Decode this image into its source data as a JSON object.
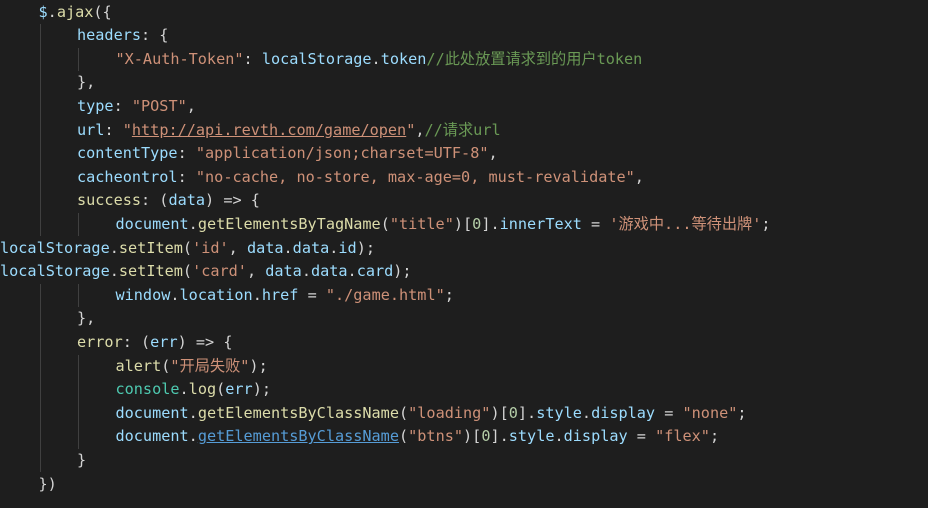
{
  "editor": {
    "lines": [
      {
        "indent": 1,
        "tokens": [
          [
            "var",
            "$"
          ],
          [
            "pun",
            "."
          ],
          [
            "fn",
            "ajax"
          ],
          [
            "pun",
            "({"
          ]
        ]
      },
      {
        "indent": 2,
        "tokens": [
          [
            "var",
            "headers"
          ],
          [
            "pun",
            ": {"
          ]
        ]
      },
      {
        "indent": 3,
        "tokens": [
          [
            "str",
            "\"X-Auth-Token\""
          ],
          [
            "pun",
            ": "
          ],
          [
            "var",
            "localStorage"
          ],
          [
            "pun",
            "."
          ],
          [
            "var",
            "token"
          ],
          [
            "cmt",
            "//此处放置请求到的用户token"
          ]
        ]
      },
      {
        "indent": 2,
        "tokens": [
          [
            "pun",
            "},"
          ]
        ]
      },
      {
        "indent": 2,
        "tokens": [
          [
            "var",
            "type"
          ],
          [
            "pun",
            ": "
          ],
          [
            "str",
            "\"POST\""
          ],
          [
            "pun",
            ","
          ]
        ]
      },
      {
        "indent": 2,
        "tokens": [
          [
            "var",
            "url"
          ],
          [
            "pun",
            ": "
          ],
          [
            "str",
            "\""
          ],
          [
            "url",
            "http://api.revth.com/game/open"
          ],
          [
            "str",
            "\""
          ],
          [
            "pun",
            ","
          ],
          [
            "cmt",
            "//请求url"
          ]
        ]
      },
      {
        "indent": 2,
        "tokens": [
          [
            "var",
            "contentType"
          ],
          [
            "pun",
            ": "
          ],
          [
            "str",
            "\"application/json;charset=UTF-8\""
          ],
          [
            "pun",
            ","
          ]
        ]
      },
      {
        "indent": 2,
        "tokens": [
          [
            "var",
            "cacheontrol"
          ],
          [
            "pun",
            ": "
          ],
          [
            "str",
            "\"no-cache, no-store, max-age=0, must-revalidate\""
          ],
          [
            "pun",
            ","
          ]
        ]
      },
      {
        "indent": 2,
        "tokens": [
          [
            "fn",
            "success"
          ],
          [
            "pun",
            ": ("
          ],
          [
            "var",
            "data"
          ],
          [
            "pun",
            ") "
          ],
          [
            "op",
            "=>"
          ],
          [
            "pun",
            " {"
          ]
        ]
      },
      {
        "indent": 3,
        "tokens": [
          [
            "var",
            "document"
          ],
          [
            "pun",
            "."
          ],
          [
            "fn",
            "getElementsByTagName"
          ],
          [
            "pun",
            "("
          ],
          [
            "str",
            "\"title\""
          ],
          [
            "pun",
            ")["
          ],
          [
            "num",
            "0"
          ],
          [
            "pun",
            "]."
          ],
          [
            "var",
            "innerText"
          ],
          [
            "op",
            " = "
          ],
          [
            "str",
            "'游戏中...等待出牌'"
          ],
          [
            "pun",
            ";"
          ]
        ]
      },
      {
        "indent": 0,
        "tokens": [
          [
            "var",
            "localStorage"
          ],
          [
            "pun",
            "."
          ],
          [
            "fn",
            "setItem"
          ],
          [
            "pun",
            "("
          ],
          [
            "str",
            "'id'"
          ],
          [
            "pun",
            ", "
          ],
          [
            "var",
            "data"
          ],
          [
            "pun",
            "."
          ],
          [
            "var",
            "data"
          ],
          [
            "pun",
            "."
          ],
          [
            "var",
            "id"
          ],
          [
            "pun",
            ");"
          ]
        ]
      },
      {
        "indent": 0,
        "tokens": [
          [
            "var",
            "localStorage"
          ],
          [
            "pun",
            "."
          ],
          [
            "fn",
            "setItem"
          ],
          [
            "pun",
            "("
          ],
          [
            "str",
            "'card'"
          ],
          [
            "pun",
            ", "
          ],
          [
            "var",
            "data"
          ],
          [
            "pun",
            "."
          ],
          [
            "var",
            "data"
          ],
          [
            "pun",
            "."
          ],
          [
            "var",
            "card"
          ],
          [
            "pun",
            ");"
          ]
        ]
      },
      {
        "indent": 3,
        "tokens": [
          [
            "var",
            "window"
          ],
          [
            "pun",
            "."
          ],
          [
            "var",
            "location"
          ],
          [
            "pun",
            "."
          ],
          [
            "var",
            "href"
          ],
          [
            "op",
            " = "
          ],
          [
            "str",
            "\"./game.html\""
          ],
          [
            "pun",
            ";"
          ]
        ]
      },
      {
        "indent": 2,
        "tokens": [
          [
            "pun",
            "},"
          ]
        ]
      },
      {
        "indent": 2,
        "tokens": [
          [
            "fn",
            "error"
          ],
          [
            "pun",
            ": ("
          ],
          [
            "var",
            "err"
          ],
          [
            "pun",
            ") "
          ],
          [
            "op",
            "=>"
          ],
          [
            "pun",
            " {"
          ]
        ]
      },
      {
        "indent": 3,
        "tokens": [
          [
            "fn",
            "alert"
          ],
          [
            "pun",
            "("
          ],
          [
            "str",
            "\"开局失败\""
          ],
          [
            "pun",
            ");"
          ]
        ]
      },
      {
        "indent": 3,
        "tokens": [
          [
            "cls",
            "console"
          ],
          [
            "pun",
            "."
          ],
          [
            "fn",
            "log"
          ],
          [
            "pun",
            "("
          ],
          [
            "var",
            "err"
          ],
          [
            "pun",
            ");"
          ]
        ]
      },
      {
        "indent": 3,
        "tokens": [
          [
            "var",
            "document"
          ],
          [
            "pun",
            "."
          ],
          [
            "fn",
            "getElementsByClassName"
          ],
          [
            "pun",
            "("
          ],
          [
            "str",
            "\"loading\""
          ],
          [
            "pun",
            ")["
          ],
          [
            "num",
            "0"
          ],
          [
            "pun",
            "]."
          ],
          [
            "var",
            "style"
          ],
          [
            "pun",
            "."
          ],
          [
            "var",
            "display"
          ],
          [
            "op",
            " = "
          ],
          [
            "str",
            "\"none\""
          ],
          [
            "pun",
            ";"
          ]
        ]
      },
      {
        "indent": 3,
        "tokens": [
          [
            "var",
            "document"
          ],
          [
            "pun",
            "."
          ],
          [
            "fnlink",
            "getElementsByClassName"
          ],
          [
            "pun",
            "("
          ],
          [
            "str",
            "\"btns\""
          ],
          [
            "pun",
            ")["
          ],
          [
            "num",
            "0"
          ],
          [
            "pun",
            "]."
          ],
          [
            "var",
            "style"
          ],
          [
            "pun",
            "."
          ],
          [
            "var",
            "display"
          ],
          [
            "op",
            " = "
          ],
          [
            "str",
            "\"flex\""
          ],
          [
            "pun",
            ";"
          ]
        ]
      },
      {
        "indent": 2,
        "tokens": [
          [
            "pun",
            "}"
          ]
        ]
      },
      {
        "indent": 1,
        "tokens": [
          [
            "pun",
            "})"
          ]
        ]
      }
    ]
  }
}
